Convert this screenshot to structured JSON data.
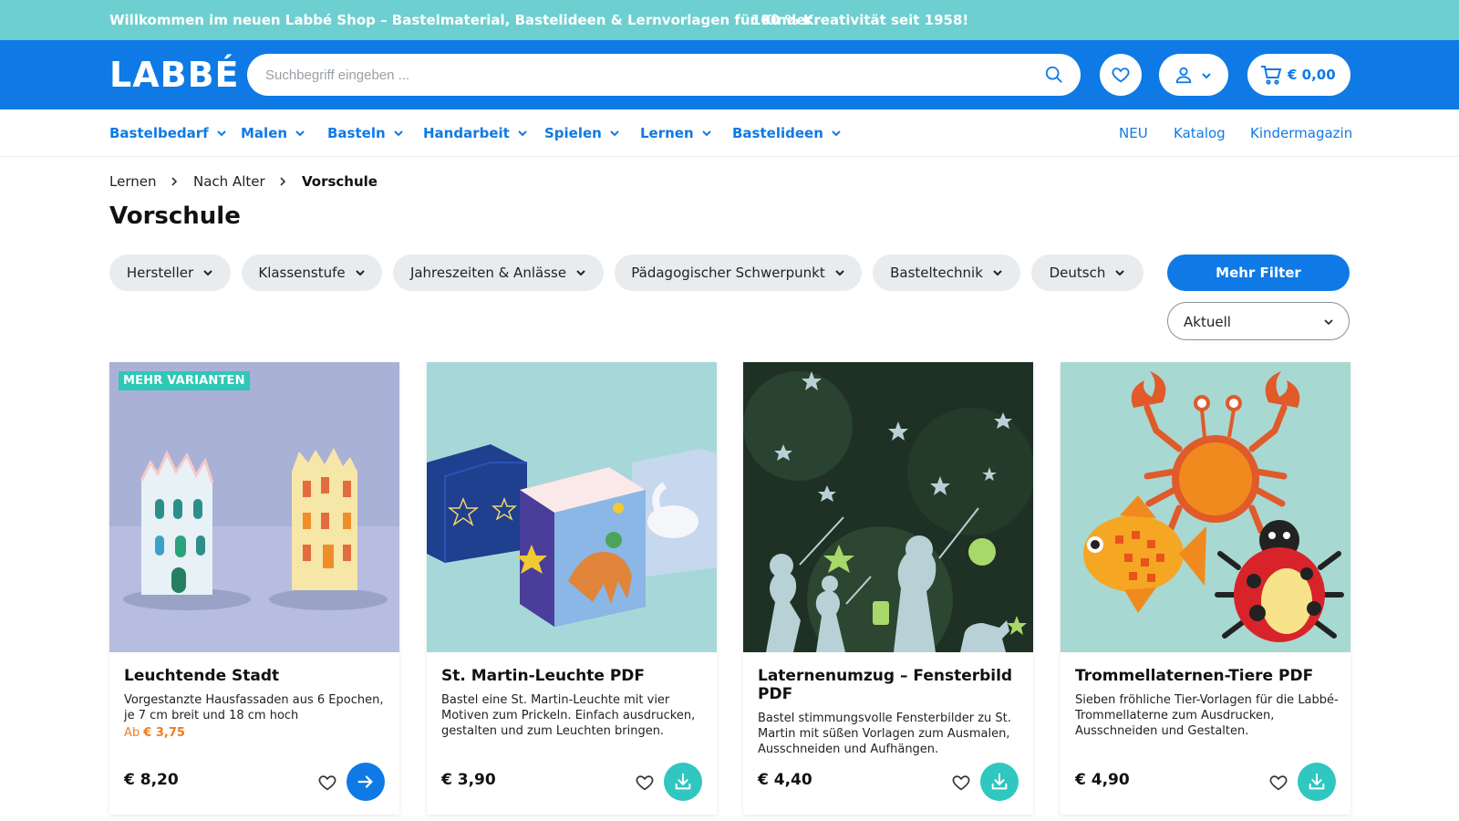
{
  "promo": {
    "left": "Willkommen im neuen Labbé Shop – Bastelmaterial, Bastelideen & Lernvorlagen für Kinder",
    "right": "100 % Kreativität seit 1958!"
  },
  "header": {
    "logo": "LABBÉ",
    "search_placeholder": "Suchbegriff eingeben ...",
    "cart_amount": "€ 0,00"
  },
  "nav": {
    "categories": [
      "Bastelbedarf",
      "Malen",
      "Basteln",
      "Handarbeit",
      "Spielen",
      "Lernen",
      "Bastelideen"
    ],
    "links": [
      "NEU",
      "Katalog",
      "Kindermagazin"
    ]
  },
  "breadcrumb": [
    "Lernen",
    "Nach Alter",
    "Vorschule"
  ],
  "page_title": "Vorschule",
  "filters": [
    "Hersteller",
    "Klassenstufe",
    "Jahreszeiten & Anlässe",
    "Pädagogischer Schwerpunkt",
    "Basteltechnik",
    "Deutsch"
  ],
  "more_filters": "Mehr Filter",
  "sort": {
    "selected": "Aktuell"
  },
  "products": [
    {
      "badge": "MEHR VARIANTEN",
      "name": "Leuchtende Stadt",
      "description": "Vorgestanzte Hausfassaden aus 6 Epochen, je 7 cm breit und 18 cm hoch",
      "from_label": "Ab",
      "from_price": "€ 3,75",
      "price": "€ 8,20",
      "action": "arrow"
    },
    {
      "name": "St. Martin-Leuchte PDF",
      "description": "Bastel eine St. Martin-Leuchte mit vier Motiven zum Prickeln. Einfach ausdrucken, gestalten und zum Leuchten bringen.",
      "price": "€ 3,90",
      "action": "download"
    },
    {
      "name": "Laternenumzug – Fensterbild PDF",
      "description": "Bastel stimmungsvolle Fensterbilder zu St. Martin mit süßen Vorlagen zum Ausmalen, Ausschneiden und Aufhängen.",
      "price": "€ 4,40",
      "action": "download"
    },
    {
      "name": "Trommellaternen-Tiere PDF",
      "description": "Sieben fröhliche Tier-Vorlagen für die Labbé-Trommellaterne zum Ausdrucken, Ausschneiden und Gestalten.",
      "price": "€ 4,90",
      "action": "download"
    }
  ],
  "colors": {
    "promo_bg": "#6dcfd0",
    "brand_blue": "#0f7ae5",
    "teal": "#2fc7c0",
    "orange_price": "#f07d1f"
  }
}
